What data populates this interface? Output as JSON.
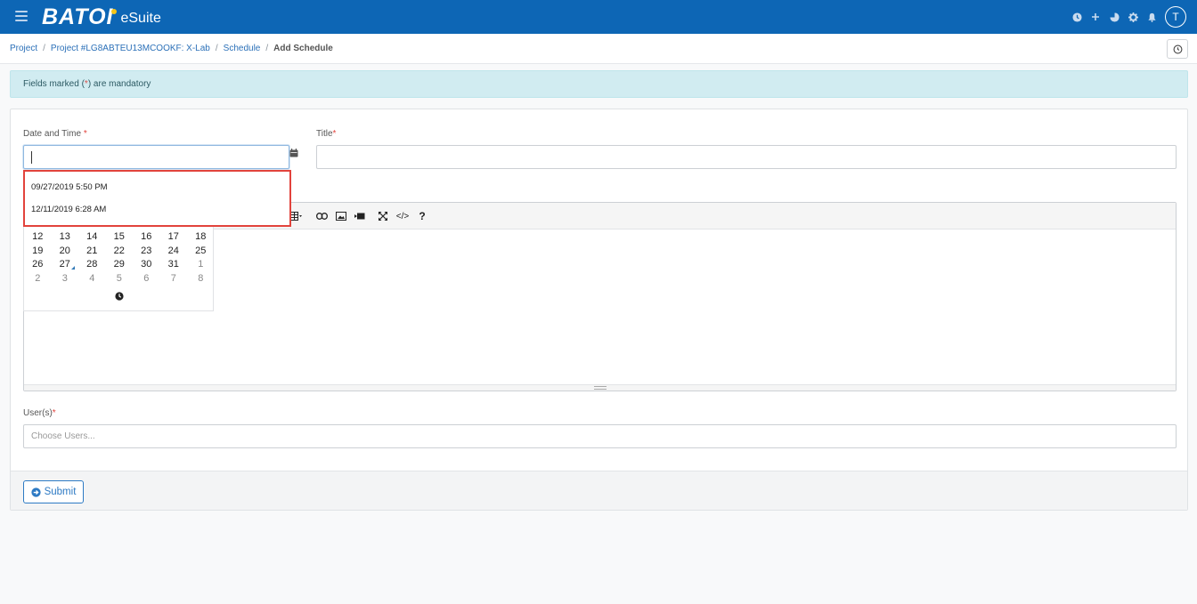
{
  "app": {
    "brand": "BATOI",
    "brand_sub": "eSuite",
    "avatar_initial": "T",
    "accent_color": "#0d66b5",
    "header_icons": [
      "clock-icon",
      "plus-icon",
      "pie-chart-icon",
      "gear-icon",
      "bell-icon"
    ]
  },
  "breadcrumb": {
    "items": [
      "Project",
      "Project #LG8ABTEU13MCOOKF: X-Lab",
      "Schedule"
    ],
    "separator": "/",
    "current": "Add Schedule"
  },
  "alert": {
    "prefix": "Fields marked (",
    "marker": "*",
    "suffix": ") are mandatory"
  },
  "form": {
    "datetime_label": "Date and Time",
    "title_label": "Title",
    "users_label": "User(s)",
    "users_placeholder": "Choose Users...",
    "required_marker": "*",
    "submit_label": "Submit"
  },
  "suggestions": [
    "09/27/2019 5:50 PM",
    "12/11/2019 6:28 AM"
  ],
  "calendar": {
    "weeks": [
      [
        "12",
        "13",
        "14",
        "15",
        "16",
        "17",
        "18"
      ],
      [
        "19",
        "20",
        "21",
        "22",
        "23",
        "24",
        "25"
      ],
      [
        "26",
        "27",
        "28",
        "29",
        "30",
        "31",
        "1"
      ],
      [
        "2",
        "3",
        "4",
        "5",
        "6",
        "7",
        "8"
      ]
    ],
    "today": "27",
    "muted_from_row": 2
  },
  "editor": {
    "toolbar_icons": [
      "table-icon",
      "link-icon",
      "picture-icon",
      "video-icon",
      "fullscreen-icon",
      "code-view-icon",
      "help-icon"
    ],
    "help_label": "?",
    "code_label": "</>"
  }
}
